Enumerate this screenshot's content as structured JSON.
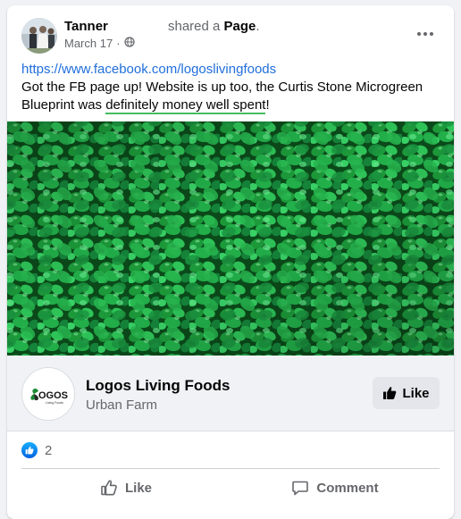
{
  "post": {
    "author": "Tanner",
    "shared_prefix": "shared a ",
    "shared_object": "Page",
    "shared_suffix": ".",
    "date": "March 17",
    "date_separator": "·",
    "privacy_icon": "globe-icon",
    "more_icon": "more-horizontal-icon",
    "link": "https://www.facebook.com/logoslivingfoods",
    "text_before": "Got the FB page up! Website is up too, the Curtis Stone Microgreen Blueprint was ",
    "text_highlight": "definitely money well spent",
    "text_after": "!"
  },
  "page_preview": {
    "name": "Logos Living Foods",
    "category": "Urban Farm",
    "logo_text": "OGOS",
    "logo_subtext": "Living Foods",
    "like_label": "Like",
    "like_icon": "thumbs-up-icon"
  },
  "reactions": {
    "count": "2",
    "icon": "like-reaction-icon"
  },
  "actions": {
    "like_label": "Like",
    "comment_label": "Comment"
  },
  "colors": {
    "link": "#216fdb",
    "highlight_underline": "#45bd62",
    "reaction_blue": "#0866ff",
    "muted_text": "#65676b"
  }
}
